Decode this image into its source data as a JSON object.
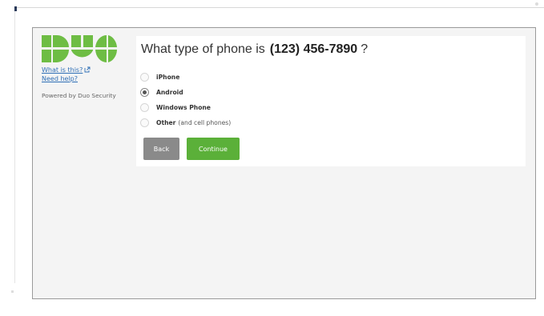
{
  "sidebar": {
    "logo": "duo-logo",
    "what_is_this": "What is this?",
    "need_help": "Need help?",
    "powered_by": "Powered by Duo Security"
  },
  "question": {
    "prefix": "What type of phone is",
    "phone_number": "(123) 456-7890",
    "suffix": "?"
  },
  "options": [
    {
      "label": "iPhone",
      "note": "",
      "selected": false
    },
    {
      "label": "Android",
      "note": "",
      "selected": true
    },
    {
      "label": "Windows Phone",
      "note": "",
      "selected": false
    },
    {
      "label": "Other",
      "note": "(and cell phones)",
      "selected": false
    }
  ],
  "buttons": {
    "back": "Back",
    "continue": "Continue"
  },
  "colors": {
    "brand_green": "#5bb039",
    "back_gray": "#8a8a8a",
    "link_blue": "#2f6fb6"
  }
}
